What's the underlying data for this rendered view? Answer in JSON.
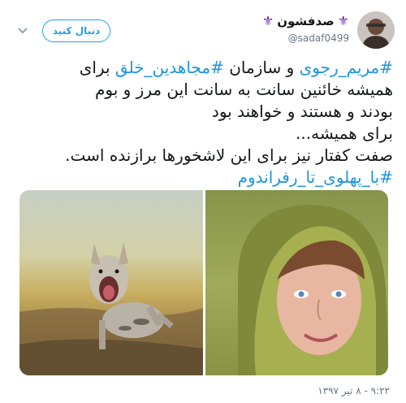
{
  "header": {
    "display_name": "صدفشون",
    "handle": "@sadaf0499",
    "follow_label": "دنبال کنید",
    "fleur_color": "#6a2ea3"
  },
  "tweet": {
    "line1": {
      "hashtag1": "#مریم_رجوی",
      "mid": " و سازمان ",
      "hashtag2": "#مجاهدین_خلق",
      "end": " برای"
    },
    "line2": "همیشه خائنین سانت به سانت این مرز و بوم",
    "line3": "بودند و هستند و خواهند بود",
    "line4": "برای همیشه...",
    "line5": "صفت کفتار نیز برای این لاشخورها برازنده است.",
    "hashtag3": "#با_پهلوی_تا_رفراندوم"
  },
  "media": {
    "images": [
      "hyena-photo",
      "woman-portrait-photo"
    ]
  },
  "timestamp": "۹:۲۲ - ۸ تیر ۱۳۹۷",
  "colors": {
    "link": "#1b95e0",
    "accent": "#1da1f2",
    "secondary_text": "#657786"
  }
}
